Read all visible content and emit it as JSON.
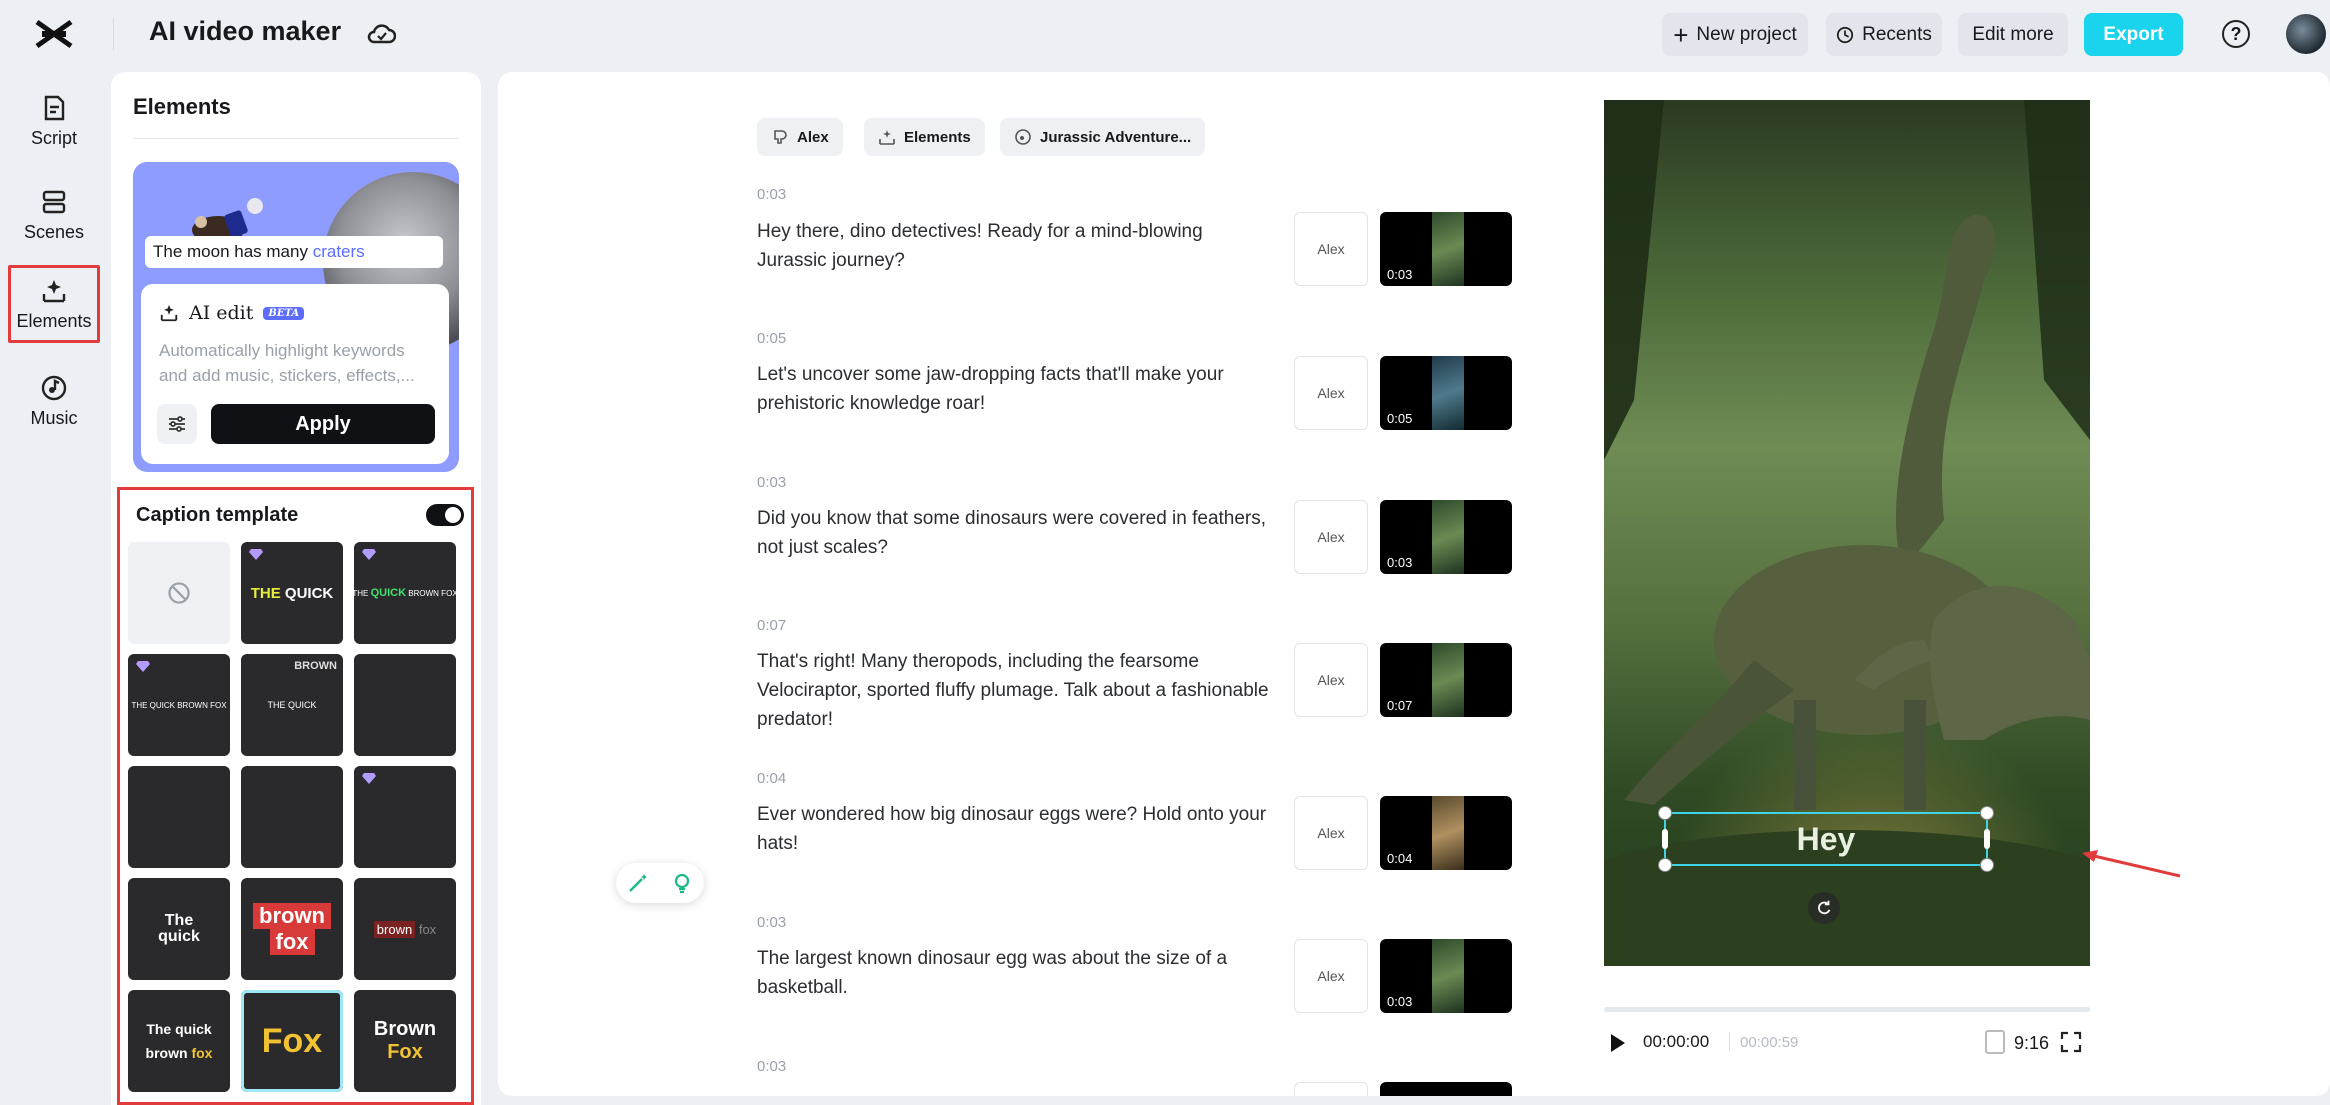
{
  "header": {
    "app_title": "AI video maker",
    "new_project": "New project",
    "recents": "Recents",
    "edit_more": "Edit more",
    "export": "Export",
    "help": "?"
  },
  "rail": {
    "items": [
      {
        "label": "Script",
        "icon": "script-icon"
      },
      {
        "label": "Scenes",
        "icon": "scenes-icon"
      },
      {
        "label": "Elements",
        "icon": "elements-icon",
        "selected": true
      },
      {
        "label": "Music",
        "icon": "music-icon"
      }
    ]
  },
  "panel": {
    "title": "Elements",
    "promo": {
      "caption_prefix": "The moon has many ",
      "caption_keyword": "craters"
    },
    "ai_edit": {
      "title": "AI edit",
      "badge": "BETA",
      "desc_line1": "Automatically highlight keywords",
      "desc_line2": "and add music, stickers, effects,...",
      "apply": "Apply"
    },
    "caption_template": {
      "title": "Caption template",
      "enabled": true,
      "templates": [
        {
          "kind": "none"
        },
        {
          "premium": true,
          "w1": "THE",
          "w2": "QUICK"
        },
        {
          "premium": true,
          "w1": "THE",
          "w2": "QUICK",
          "w3": "BROWN FOX"
        },
        {
          "premium": true,
          "w1": "THE QUICK BROWN FOX"
        },
        {
          "w1": "THE QUICK",
          "w2": "BROWN"
        },
        {},
        {},
        {},
        {
          "premium": true
        },
        {
          "w1": "The",
          "w2": "quick"
        },
        {
          "w1": "brown",
          "w2": "fox"
        },
        {
          "w1": "brown",
          "w2": "fox"
        },
        {
          "w1": "The quick",
          "w2": "brown",
          "w3": "fox"
        },
        {
          "w1": "Fox",
          "selected": true
        },
        {
          "w1": "Brown",
          "w2": "Fox"
        }
      ]
    }
  },
  "main": {
    "chips": [
      {
        "label": "Alex",
        "icon": "voice-icon"
      },
      {
        "label": "Elements",
        "icon": "elements-icon"
      },
      {
        "label": "Jurassic Adventure...",
        "icon": "music-icon"
      }
    ],
    "scenes": [
      {
        "time": "0:03",
        "text": "Hey there, dino detectives! Ready for a mind-blowing Jurassic journey?",
        "voice": "Alex",
        "dur": "0:03"
      },
      {
        "time": "0:05",
        "text": "Let's uncover some jaw-dropping facts that'll make your prehistoric knowledge roar!",
        "voice": "Alex",
        "dur": "0:05"
      },
      {
        "time": "0:03",
        "text": "Did you know that some dinosaurs were covered in feathers, not just scales?",
        "voice": "Alex",
        "dur": "0:03"
      },
      {
        "time": "0:07",
        "text": "That's right! Many theropods, including the fearsome Velociraptor, sported fluffy plumage. Talk about a fashionable predator!",
        "voice": "Alex",
        "dur": "0:07"
      },
      {
        "time": "0:04",
        "text": "Ever wondered how big dinosaur eggs were? Hold onto your hats!",
        "voice": "Alex",
        "dur": "0:04"
      },
      {
        "time": "0:03",
        "text": "The largest known dinosaur egg was about the size of a basketball.",
        "voice": "Alex",
        "dur": "0:03"
      },
      {
        "time": "0:03",
        "text": "",
        "voice": "",
        "dur": ""
      }
    ],
    "preview": {
      "caption": "Hey",
      "current_time": "00:00:00",
      "total_time": "00:00:59",
      "ratio": "9:16",
      "progress": 0
    }
  },
  "colors": {
    "accent": "#1ad3ed",
    "highlight": "#e23b3b",
    "selection": "#3fd3e6",
    "kw": "#5b6cff"
  }
}
